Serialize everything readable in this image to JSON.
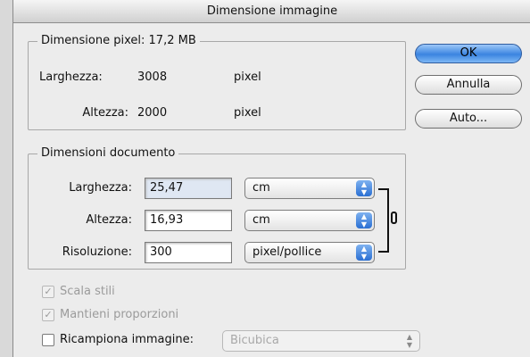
{
  "window": {
    "title": "Dimensione immagine"
  },
  "pixel_dimensions": {
    "title": "Dimensione pixel:",
    "size": "17,2 MB",
    "width_label": "Larghezza:",
    "width_value": "3008",
    "width_unit": "pixel",
    "height_label": "Altezza:",
    "height_value": "2000",
    "height_unit": "pixel"
  },
  "document_size": {
    "title": "Dimensioni documento",
    "width_label": "Larghezza:",
    "width_value": "25,47",
    "width_unit": "cm",
    "height_label": "Altezza:",
    "height_value": "16,93",
    "height_unit": "cm",
    "resolution_label": "Risoluzione:",
    "resolution_value": "300",
    "resolution_unit": "pixel/pollice"
  },
  "options": {
    "scale_styles": "Scala stili",
    "constrain": "Mantieni proporzioni",
    "resample": "Ricampiona immagine:",
    "resample_method": "Bicubica"
  },
  "buttons": {
    "ok": "OK",
    "cancel": "Annulla",
    "auto": "Auto..."
  }
}
